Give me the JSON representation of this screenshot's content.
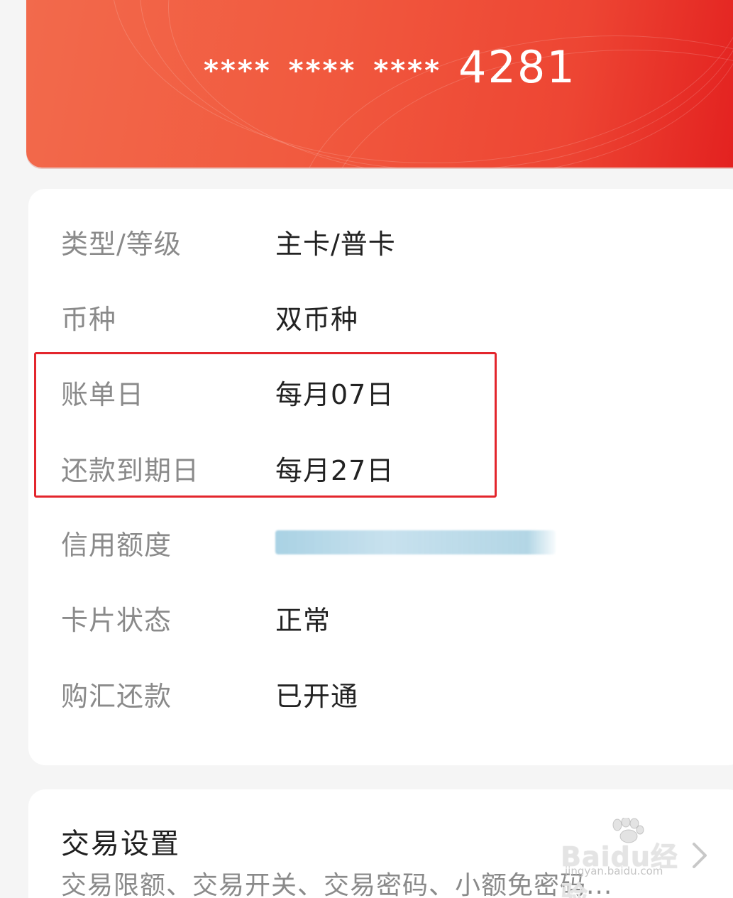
{
  "card": {
    "masked_groups": [
      "****",
      "****",
      "****"
    ],
    "last4": "4281"
  },
  "info": {
    "rows": [
      {
        "label": "类型/等级",
        "value": "主卡/普卡"
      },
      {
        "label": "币种",
        "value": "双币种"
      },
      {
        "label": "账单日",
        "value": "每月07日"
      },
      {
        "label": "还款到期日",
        "value": "每月27日"
      },
      {
        "label": "信用额度",
        "value": ""
      },
      {
        "label": "卡片状态",
        "value": "正常"
      },
      {
        "label": "购汇还款",
        "value": "已开通"
      }
    ]
  },
  "transaction_settings": {
    "title": "交易设置",
    "subtitle": "交易限额、交易开关、交易密码、小额免密码..."
  },
  "watermark": {
    "text": "Baidu经验",
    "url": "jingyan.baidu.com"
  },
  "colors": {
    "card_start": "#f26a4c",
    "card_end": "#e21e1e",
    "highlight_border": "#e3262d",
    "label": "#8a8a8a",
    "value": "#222222"
  },
  "icons": [
    "chevron-right-icon",
    "baidu-paw-icon"
  ]
}
